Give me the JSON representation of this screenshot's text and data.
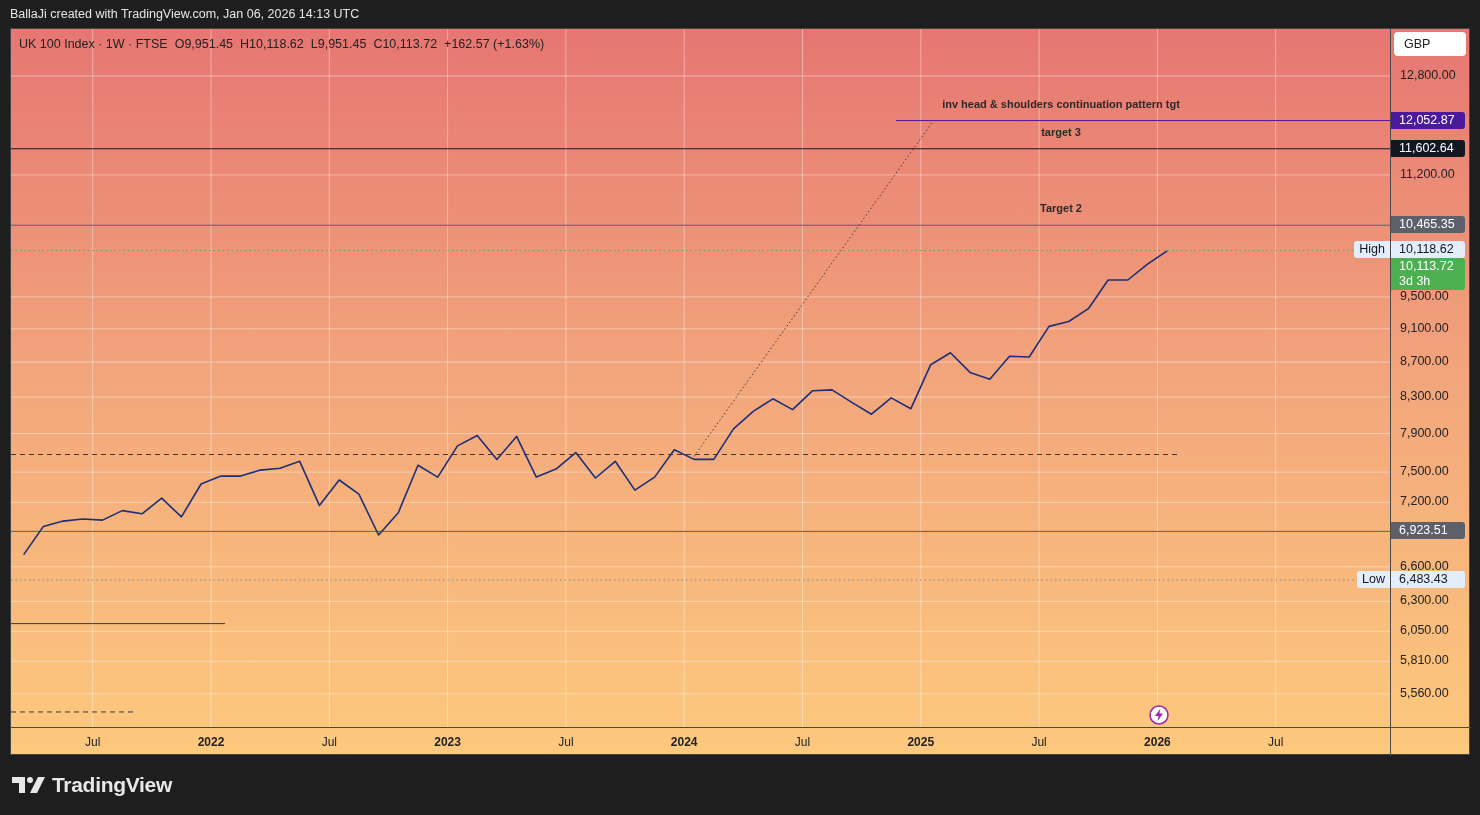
{
  "header": {
    "caption": "BallaJi created with TradingView.com, Jan 06, 2026 14:13 UTC"
  },
  "legend": {
    "symbol": "UK 100 Index · 1W · FTSE",
    "values": [
      "O9,951.45",
      "H10,118.62",
      "L9,951.45",
      "C10,113.72",
      "+162.57 (+1.63%)"
    ]
  },
  "currency_button": {
    "label": "GBP"
  },
  "price_axis": {
    "labels": [
      "12,800.00",
      "11,200.00",
      "9,500.00",
      "9,100.00",
      "8,700.00",
      "8,300.00",
      "7,900.00",
      "7,500.00",
      "7,200.00",
      "6,600.00",
      "6,300.00",
      "6,050.00",
      "5,810.00",
      "5,560.00"
    ]
  },
  "time_axis": {
    "labels": [
      {
        "text": "Jul",
        "major": false
      },
      {
        "text": "2022",
        "major": true
      },
      {
        "text": "Jul",
        "major": false
      },
      {
        "text": "2023",
        "major": true
      },
      {
        "text": "Jul",
        "major": false
      },
      {
        "text": "2024",
        "major": true
      },
      {
        "text": "Jul",
        "major": false
      },
      {
        "text": "2025",
        "major": true
      },
      {
        "text": "Jul",
        "major": false
      },
      {
        "text": "2026",
        "major": true
      },
      {
        "text": "Jul",
        "major": false
      }
    ]
  },
  "price_levels": [
    {
      "kind": "target",
      "color": "#4a1a9a",
      "text": "inv head & shoulders continuation pattern tgt",
      "price_label": "12,052.87"
    },
    {
      "kind": "level",
      "color": "#131722",
      "text": "target 3",
      "price_label": "11,602.64"
    },
    {
      "kind": "level",
      "color": "#5d606b",
      "text": "Target 2",
      "price_label": "10,465.35"
    },
    {
      "kind": "high",
      "color": "#e3eefc",
      "tag": "High",
      "price_label": "10,118.62"
    },
    {
      "kind": "last",
      "color": "#4caf50",
      "price_label": "10,113.72",
      "countdown": "3d 3h"
    },
    {
      "kind": "level",
      "color": "#5d606b",
      "price_label": "6,923.51"
    },
    {
      "kind": "low",
      "color": "#e3eefc",
      "tag": "Low",
      "price_label": "6,483.43"
    }
  ],
  "footer": {
    "brand": "TradingView"
  }
}
